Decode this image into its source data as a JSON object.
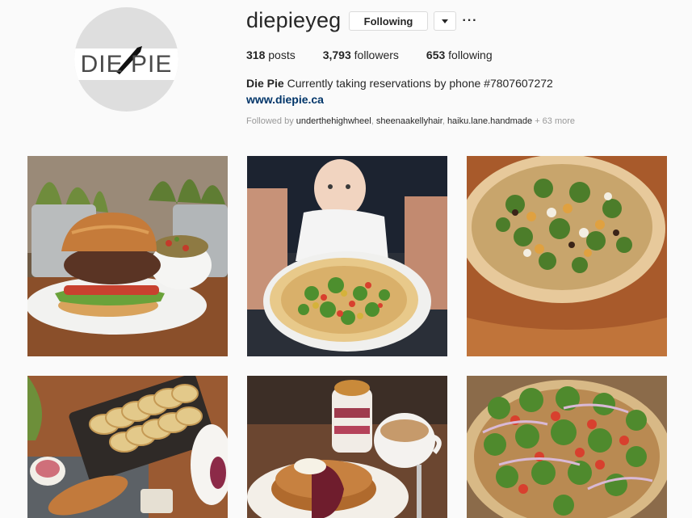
{
  "profile": {
    "username": "diepieyeg",
    "avatar_logo_text": "DIE PIE",
    "following_button_label": "Following",
    "dropdown_icon": "caret-down-icon",
    "more_label": "···",
    "stats": {
      "posts_count": "318",
      "posts_label": "posts",
      "followers_count": "3,793",
      "followers_label": "followers",
      "following_count": "653",
      "following_label": "following"
    },
    "bio_name": "Die Pie",
    "bio_text": "Currently taking reservations by phone #7807607272",
    "website": "www.diepie.ca",
    "followed_by": {
      "prefix": "Followed by",
      "users": [
        "underthehighwheel",
        "sheenaakellyhair",
        "haiku.lane.handmade"
      ],
      "more": "+ 63 more"
    }
  },
  "posts": [
    {
      "subject": "burger with salad bowl"
    },
    {
      "subject": "baby holding pizza"
    },
    {
      "subject": "pizza with arugula"
    },
    {
      "subject": "sliced bread on slate board"
    },
    {
      "subject": "pancakes with parfait and coffee"
    },
    {
      "subject": "pizza with arugula and tomatoes"
    }
  ]
}
